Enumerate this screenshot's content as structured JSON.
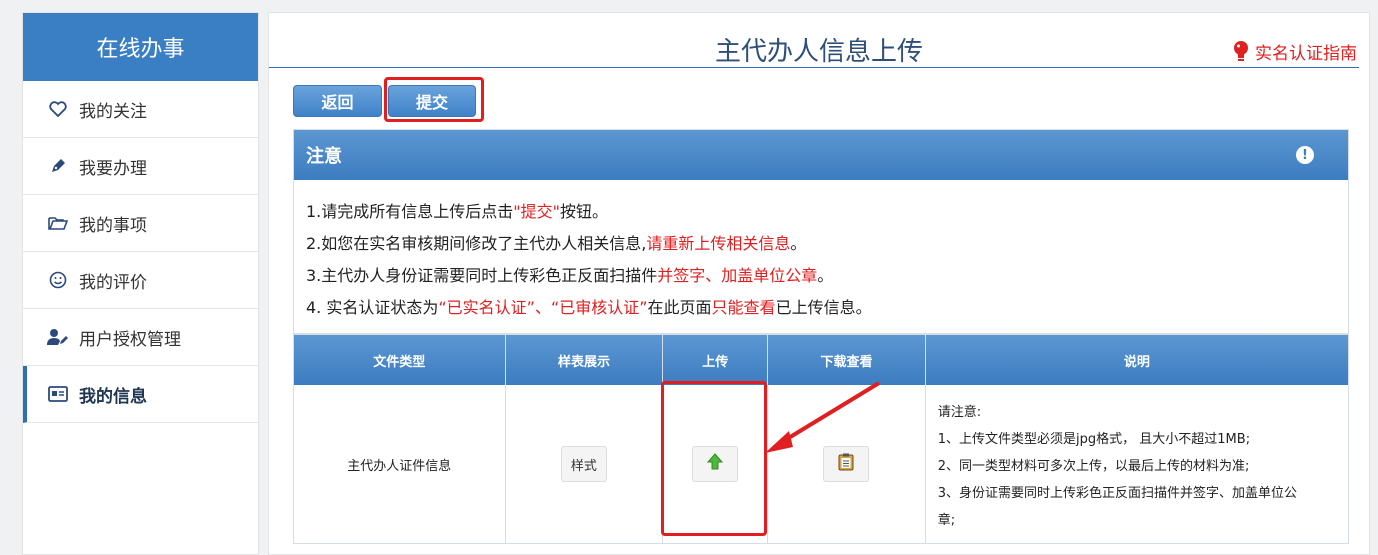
{
  "sidebar": {
    "title": "在线办事",
    "items": [
      {
        "label": "我的关注",
        "icon": "heart-icon"
      },
      {
        "label": "我要办理",
        "icon": "pen-icon"
      },
      {
        "label": "我的事项",
        "icon": "folder-icon"
      },
      {
        "label": "我的评价",
        "icon": "smile-icon"
      },
      {
        "label": "用户授权管理",
        "icon": "user-edit-icon"
      },
      {
        "label": "我的信息",
        "icon": "id-card-icon",
        "active": true
      }
    ]
  },
  "main": {
    "title": "主代办人信息上传",
    "guide_link": "实名认证指南",
    "buttons": {
      "back": "返回",
      "submit": "提交"
    },
    "notice": {
      "heading": "注意",
      "lines": [
        {
          "a": "1.请完成所有信息上传后点击",
          "b": "\"提交\"",
          "c": "按钮。"
        },
        {
          "a": "2.如您在实名审核期间修改了主代办人相关信息,",
          "b": "请重新上传相关信息",
          "c": "。"
        },
        {
          "a": "3.主代办人身份证需要同时上传彩色正反面扫描件",
          "b": "并签字、加盖单位公章",
          "c": "。"
        },
        {
          "a": "4. 实名认证状态为",
          "b": "“已实名认证”、“已审核认证”",
          "c": "在此页面",
          "d": "只能查看",
          "e": "已上传信息。"
        }
      ]
    },
    "table": {
      "headers": [
        "文件类型",
        "样表展示",
        "上传",
        "下载查看",
        "说明"
      ],
      "row": {
        "file_type": "主代办人证件信息",
        "sample_button": "样式",
        "upload_icon": "upload-arrow-icon",
        "download_icon": "clipboard-icon",
        "description": [
          "请注意:",
          "1、上传文件类型必须是jpg格式， 且大小不超过1MB;",
          "2、同一类型材料可多次上传，以最后上传的材料为准;",
          "3、身份证需要同时上传彩色正反面扫描件并签字、加盖单位公",
          "章;"
        ]
      }
    }
  },
  "colors": {
    "brand_blue": "#3a7ec4",
    "alert_red": "#e02020"
  }
}
